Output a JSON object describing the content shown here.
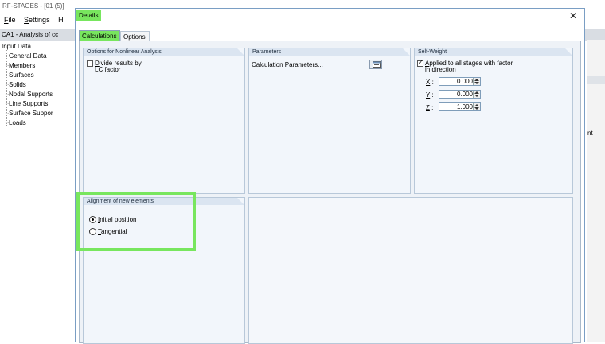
{
  "app": {
    "title": "RF-STAGES - [01 (5)]",
    "menu": [
      {
        "label": "File",
        "underline": "F",
        "rest": "ile"
      },
      {
        "label": "Settings",
        "underline": "S",
        "rest": "ettings"
      },
      {
        "label": "H",
        "underline": "",
        "rest": "H"
      }
    ],
    "case_bar": "CA1 - Analysis of cc",
    "right_edge_text": "nt"
  },
  "tree": {
    "root": "Input Data",
    "items": [
      "General Data",
      "Members",
      "Surfaces",
      "Solids",
      "Nodal Supports",
      "Line Supports",
      "Surface Suppor",
      "Loads"
    ]
  },
  "dialog": {
    "title": "Details",
    "tabs": [
      "Calculations",
      "Options"
    ],
    "nonlinear": {
      "header": "Options for Nonlinear Analysis",
      "divide_label_key": "D",
      "divide_label_rest": "ivide results by",
      "divide_label_line2": "LC factor",
      "divide_checked": false
    },
    "parameters": {
      "header": "Parameters",
      "calc_params_label": "Calculation Parameters..."
    },
    "self_weight": {
      "header": "Self-Weight",
      "applied_key": "A",
      "applied_rest": "pplied to all stages with factor",
      "applied_line2": "in direction",
      "applied_checked": true,
      "x_key": "X",
      "x_value": "0.000",
      "y_key": "Y",
      "y_value": "0.000",
      "z_key": "Z",
      "z_value": "1.000",
      "colon": ":"
    },
    "alignment": {
      "header": "Alignment of new elements",
      "initial_key": "I",
      "initial_rest": "nitial position",
      "tangential_key": "T",
      "tangential_rest": "angential",
      "selected": "initial"
    }
  },
  "colors": {
    "highlight": "#78e65e",
    "panel_header": "#dbe5f1",
    "panel_bg": "#f2f6fb"
  }
}
